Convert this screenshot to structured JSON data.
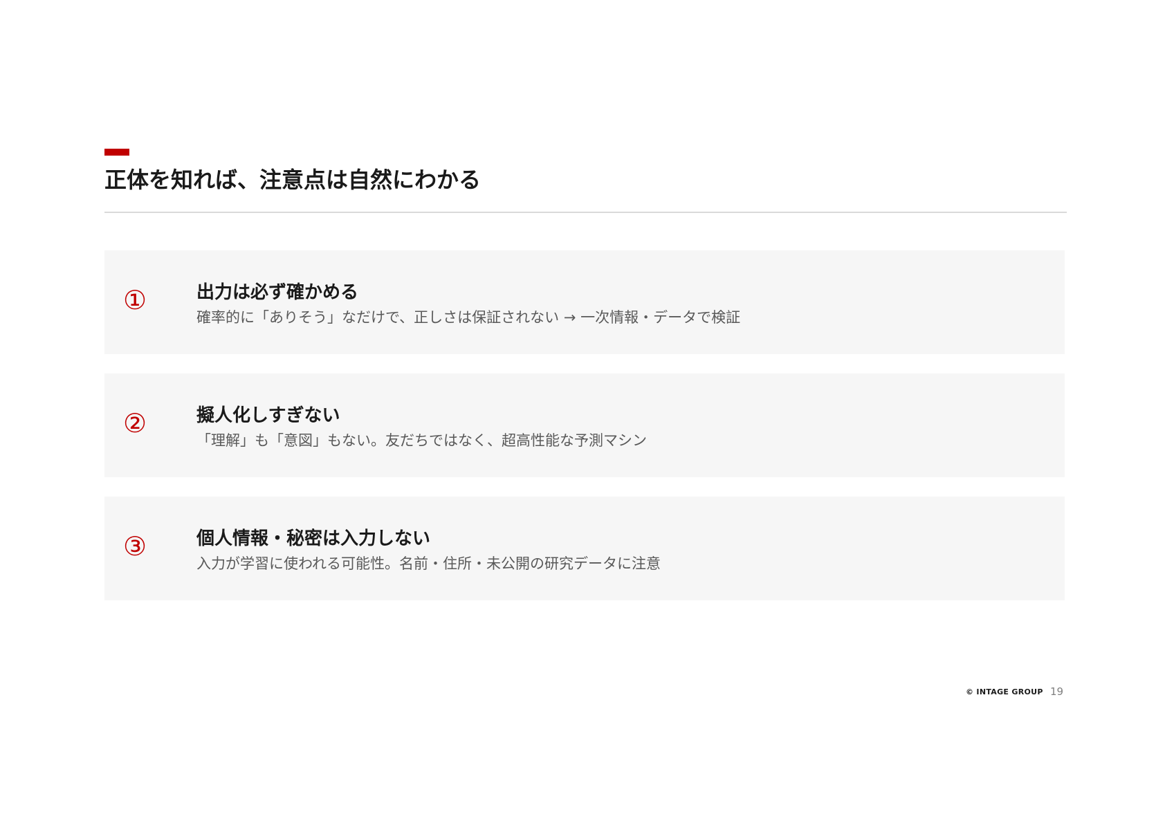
{
  "slide": {
    "title": "正体を知れば、注意点は自然にわかる",
    "accent_color": "#c00000",
    "items": [
      {
        "number": "①",
        "heading": "出力は必ず確かめる",
        "description": "確率的に「ありそう」なだけで、正しさは保証されない → 一次情報・データで検証"
      },
      {
        "number": "②",
        "heading": "擬人化しすぎない",
        "description": "「理解」も「意図」もない。友だちではなく、超高性能な予測マシン"
      },
      {
        "number": "③",
        "heading": "個人情報・秘密は入力しない",
        "description": "入力が学習に使われる可能性。名前・住所・未公開の研究データに注意"
      }
    ]
  },
  "footer": {
    "copyright": "© INTAGE GROUP",
    "page_number": "19"
  }
}
